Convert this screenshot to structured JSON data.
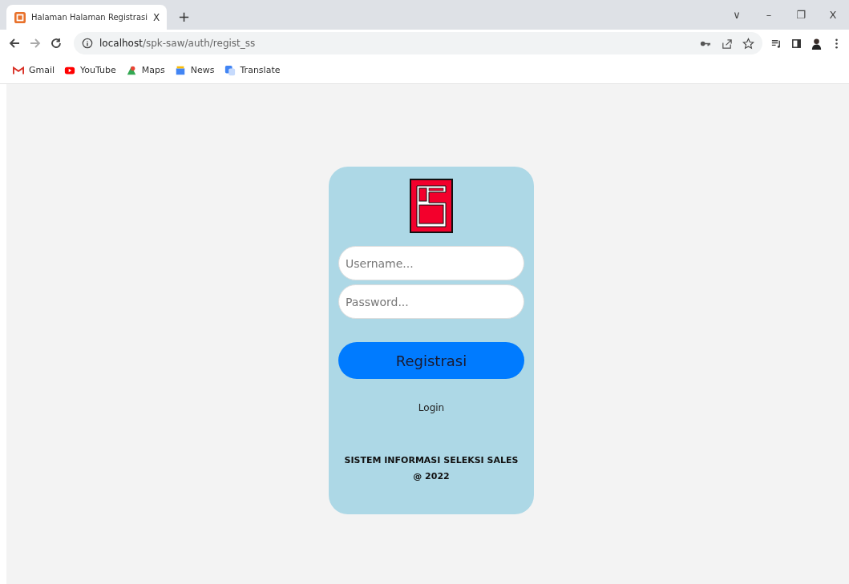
{
  "browser": {
    "tab": {
      "title": "Halaman Halaman Registrasi",
      "close": "X",
      "selected": true
    },
    "new_tab": "+",
    "window_controls": [
      "∨",
      "–",
      "❐",
      "X"
    ],
    "address": {
      "host": "localhost",
      "path": "/spk-saw/auth/regist_ss"
    },
    "bookmarks": [
      {
        "label": "Gmail",
        "kind": "gmail"
      },
      {
        "label": "YouTube",
        "kind": "youtube"
      },
      {
        "label": "Maps",
        "kind": "maps"
      },
      {
        "label": "News",
        "kind": "news"
      },
      {
        "label": "Translate",
        "kind": "translate"
      }
    ]
  },
  "form": {
    "username": {
      "placeholder": "Username..."
    },
    "password": {
      "placeholder": "Password..."
    },
    "submit": "Registrasi",
    "login_link": "Login",
    "footer": [
      "SISTEM INFORMASI SELEKSI SALES",
      "@ 2022"
    ]
  }
}
